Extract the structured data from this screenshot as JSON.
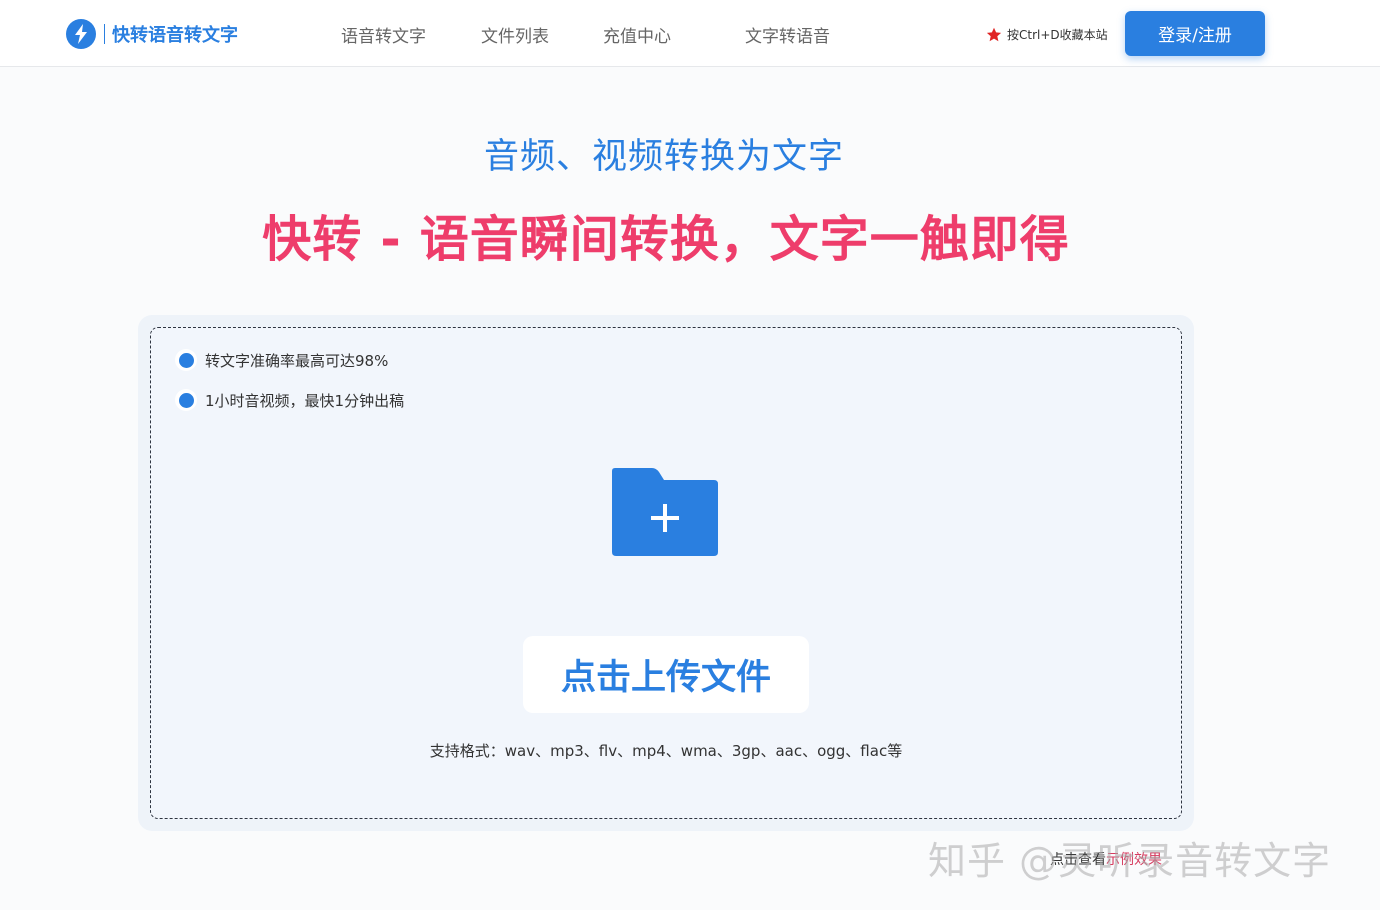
{
  "header": {
    "logo_text": "快转语音转文字",
    "nav": [
      "语音转文字",
      "文件列表",
      "充值中心",
      "文字转语音"
    ],
    "favorite_text": "按Ctrl+D收藏本站",
    "login_label": "登录/注册"
  },
  "hero": {
    "subtitle": "音频、视频转换为文字",
    "headline": "快转 - 语音瞬间转换，文字一触即得"
  },
  "upload": {
    "features": [
      "转文字准确率最高可达98%",
      "1小时音视频，最快1分钟出稿"
    ],
    "button_label": "点击上传文件",
    "formats": "支持格式：wav、mp3、flv、mp4、wma、3gp、aac、ogg、flac等",
    "folder_icon": "folder-plus-icon"
  },
  "sample": {
    "prefix": "点击查看",
    "link": "示例效果"
  },
  "watermark": "知乎 @灵听录音转文字",
  "colors": {
    "brand": "#2a7fe0",
    "headline": "#ee3d6b",
    "favorite_star": "#e02424"
  }
}
